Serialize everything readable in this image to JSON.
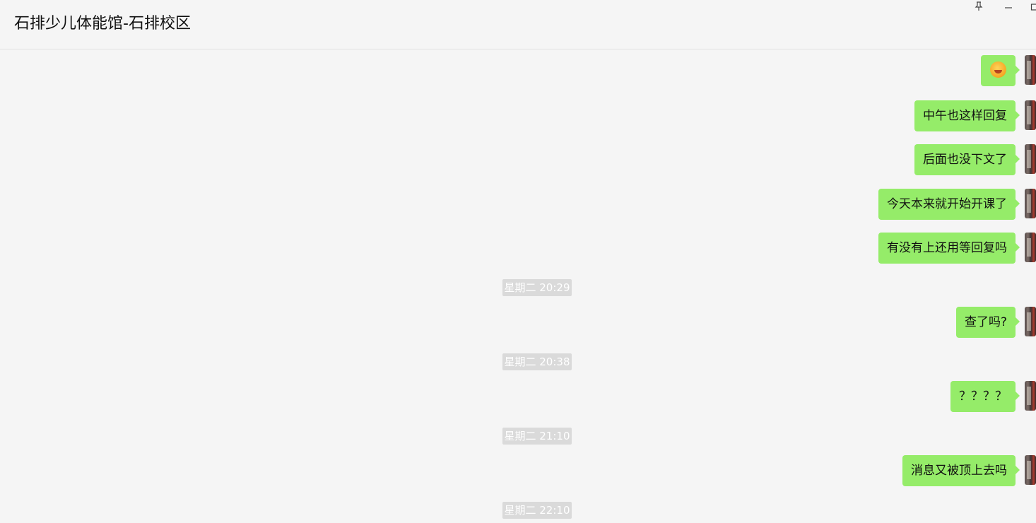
{
  "window": {
    "title": "石排少儿体能馆-石排校区",
    "controls": [
      "pin-icon",
      "minimize-icon",
      "maximize-icon"
    ]
  },
  "messages": [
    {
      "type": "emoji",
      "text": "",
      "icon": "laughing-crying-emoji-icon"
    },
    {
      "type": "text",
      "text": "中午也这样回复"
    },
    {
      "type": "text",
      "text": "后面也没下文了"
    },
    {
      "type": "text",
      "text": "今天本来就开始开课了"
    },
    {
      "type": "text",
      "text": "有没有上还用等回复吗"
    },
    {
      "type": "timestamp",
      "text": "星期二 20:29"
    },
    {
      "type": "text",
      "text": "查了吗?"
    },
    {
      "type": "timestamp",
      "text": "星期二 20:38"
    },
    {
      "type": "text",
      "text": "？？？？"
    },
    {
      "type": "timestamp",
      "text": "星期二 21:10"
    },
    {
      "type": "text",
      "text": "消息又被顶上去吗"
    },
    {
      "type": "timestamp",
      "text": "星期二 22:10"
    }
  ],
  "watermark": "",
  "colors": {
    "background": "#f5f5f5",
    "bubble": "#95ec69",
    "timestamp_bg": "#dadada",
    "timestamp_text": "#ffffff"
  }
}
